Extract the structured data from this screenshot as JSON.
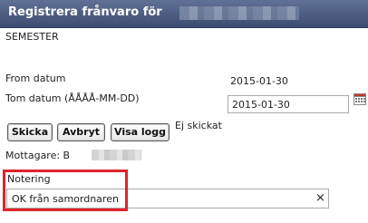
{
  "dialog": {
    "title": "Registrera frånvaro för"
  },
  "absence_type": "SEMESTER",
  "from_date": {
    "label": "From datum",
    "value": "2015-01-30"
  },
  "to_date": {
    "label": "Tom datum (ÅÅÅÅ-MM-DD)",
    "value": "2015-01-30"
  },
  "buttons": {
    "send": "Skicka",
    "cancel": "Avbryt",
    "show_log": "Visa logg"
  },
  "status": "Ej skickat",
  "recipient": {
    "label": "Mottagare: B"
  },
  "note": {
    "label": "Notering",
    "value": "OK från samordnaren",
    "clear_glyph": "×"
  },
  "colors": {
    "titlebar": "#4a5b7f",
    "highlight": "#e0222c"
  },
  "icons": {
    "calendar": "calendar-icon",
    "clear": "clear-icon"
  }
}
